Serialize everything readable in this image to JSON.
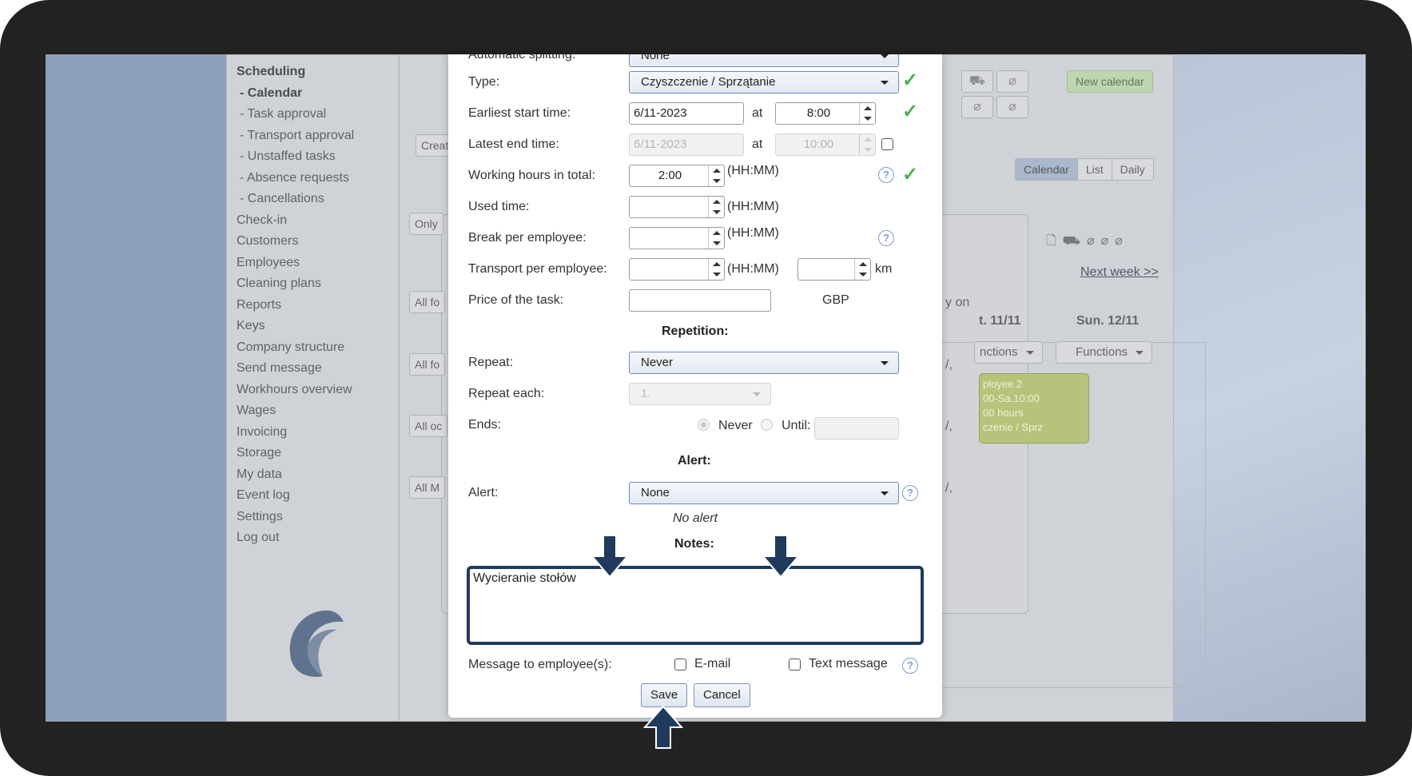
{
  "sidebar": {
    "items": [
      {
        "label": "Scheduling",
        "style": "bold"
      },
      {
        "label": "- Calendar",
        "style": "bold sub"
      },
      {
        "label": "- Task approval",
        "style": "sub"
      },
      {
        "label": "- Transport approval",
        "style": "sub"
      },
      {
        "label": "- Unstaffed tasks",
        "style": "sub"
      },
      {
        "label": "- Absence requests",
        "style": "sub"
      },
      {
        "label": "- Cancellations",
        "style": "sub"
      },
      {
        "label": "Check-in",
        "style": ""
      },
      {
        "label": "Customers",
        "style": ""
      },
      {
        "label": "Employees",
        "style": ""
      },
      {
        "label": "Cleaning plans",
        "style": ""
      },
      {
        "label": "Reports",
        "style": ""
      },
      {
        "label": "Keys",
        "style": ""
      },
      {
        "label": "Company structure",
        "style": ""
      },
      {
        "label": "Send message",
        "style": ""
      },
      {
        "label": "Workhours overview",
        "style": ""
      },
      {
        "label": "Wages",
        "style": ""
      },
      {
        "label": "Invoicing",
        "style": ""
      },
      {
        "label": "Storage",
        "style": ""
      },
      {
        "label": "My data",
        "style": ""
      },
      {
        "label": "Event log",
        "style": ""
      },
      {
        "label": "Settings",
        "style": ""
      },
      {
        "label": "Log out",
        "style": ""
      }
    ]
  },
  "background": {
    "new_calendar": "New calendar",
    "create_btn": "Creat",
    "only_btn": "Only",
    "all_fo_1": "All fo",
    "all_fo_2": "All fo",
    "all_oc": "All oc",
    "all_m": "All M",
    "view_tabs": [
      "Calendar",
      "List",
      "Daily"
    ],
    "next_week": "Next week >>",
    "day_sat": "t. 11/11",
    "day_sun": "Sun. 12/11",
    "functions_partial": "nctions",
    "functions": "Functions",
    "on_text": "y on",
    "comma1": "/,",
    "comma2": "/,",
    "comma3": "/,",
    "task_card": [
      "ployee 2",
      "00-Sa.10:00",
      "00 hours",
      "czenie / Sprz"
    ]
  },
  "modal": {
    "top_label": "Automatic splitting:",
    "top_value": "None",
    "type": {
      "label": "Type:",
      "value": "Czyszczenie / Sprzątanie"
    },
    "earliest": {
      "label": "Earliest start time:",
      "date": "6/11-2023",
      "at": "at",
      "time": "8:00"
    },
    "latest": {
      "label": "Latest end time:",
      "date": "6/11-2023",
      "at": "at",
      "time": "10:00"
    },
    "working_hours": {
      "label": "Working hours in total:",
      "value": "2:00",
      "unit": "(HH:MM)"
    },
    "used_time": {
      "label": "Used time:",
      "value": "",
      "unit": "(HH:MM)"
    },
    "break": {
      "label": "Break per employee:",
      "value": "",
      "unit": "(HH:MM)"
    },
    "transport": {
      "label": "Transport per employee:",
      "value": "",
      "unit": "(HH:MM)",
      "km_value": "",
      "km": "km"
    },
    "price": {
      "label": "Price of the task:",
      "value": "",
      "currency": "GBP"
    },
    "repetition_heading": "Repetition:",
    "repeat": {
      "label": "Repeat:",
      "value": "Never"
    },
    "repeat_each": {
      "label": "Repeat each:",
      "value": "1."
    },
    "ends": {
      "label": "Ends:",
      "never": "Never",
      "until": "Until:",
      "until_value": ""
    },
    "alert_heading": "Alert:",
    "alert": {
      "label": "Alert:",
      "value": "None",
      "note": "No alert"
    },
    "notes_heading": "Notes:",
    "notes_value": "Wycieranie stołów",
    "message": {
      "label": "Message to employee(s):",
      "email": "E-mail",
      "sms": "Text message"
    },
    "save": "Save",
    "cancel": "Cancel"
  },
  "colors": {
    "frame": "#222222",
    "accent_check": "#4caf50",
    "annotation_arrow": "#1f3a5c"
  }
}
